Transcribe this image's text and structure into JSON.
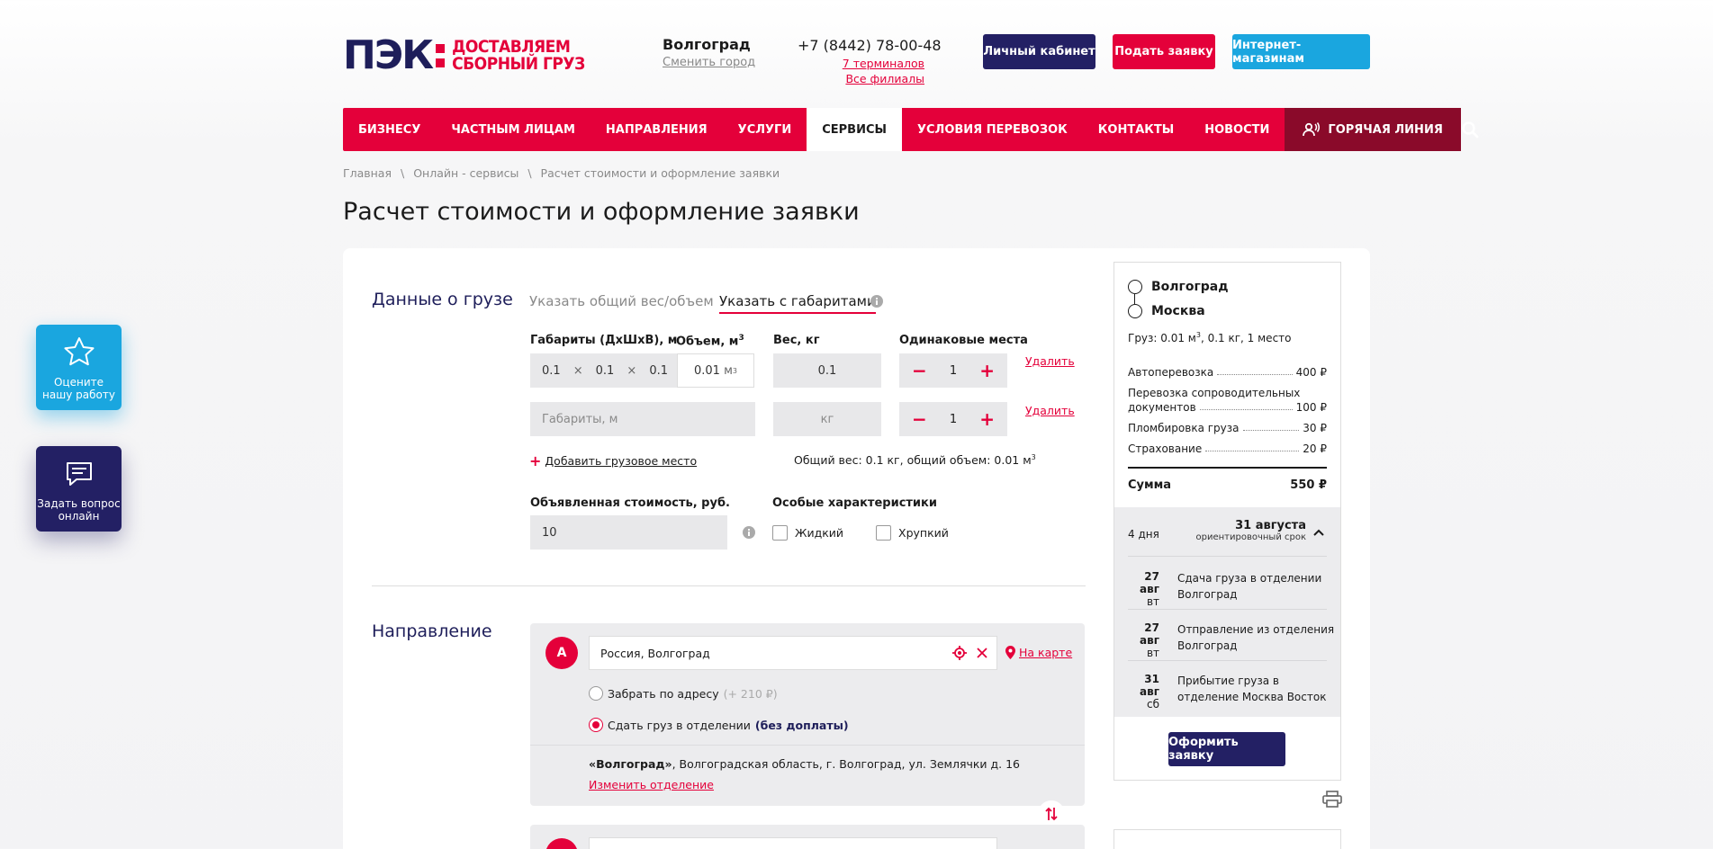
{
  "header": {
    "logo_mark": "ПЭК",
    "logo_text_1": "ДОСТАВЛЯЕМ",
    "logo_text_2": "СБОРНЫЙ ГРУЗ",
    "city": "Волгоград",
    "change_city": "Сменить город",
    "phone": "+7 (8442) 78-00-48",
    "terminals": "7 терминалов",
    "branches": "Все филиалы",
    "btn_account": "Личный кабинет",
    "btn_order": "Подать заявку",
    "btn_shops": "Интернет-магазинам"
  },
  "nav": {
    "items": [
      "БИЗНЕСУ",
      "ЧАСТНЫМ ЛИЦАМ",
      "НАПРАВЛЕНИЯ",
      "УСЛУГИ",
      "СЕРВИСЫ",
      "УСЛОВИЯ ПЕРЕВОЗОК",
      "КОНТАКТЫ",
      "НОВОСТИ"
    ],
    "hotline": "ГОРЯЧАЯ ЛИНИЯ"
  },
  "breadcrumbs": [
    "Главная",
    "\\",
    "Онлайн - сервисы",
    "\\",
    "Расчет стоимости и оформление заявки"
  ],
  "page_title": "Расчет стоимости и оформление заявки",
  "cargo": {
    "title": "Данные о грузе",
    "tab_total": "Указать общий вес/объем",
    "tab_dims": "Указать с габаритами",
    "lbl_dims": "Габариты (ДхШхВ), м",
    "lbl_volume": "Объем, м",
    "sup3": "3",
    "lbl_weight": "Вес, кг",
    "lbl_same": "Одинаковые места",
    "row1": {
      "l": "0.1",
      "w": "0.1",
      "h": "0.1",
      "x": "×",
      "volume": "0.01",
      "vol_unit": "м",
      "weight": "0.1",
      "qty": "1",
      "delete": "Удалить"
    },
    "row2": {
      "dims_placeholder": "Габариты, м",
      "weight_placeholder": "кг",
      "qty": "1",
      "delete": "Удалить"
    },
    "add_place": "Добавить грузовое место",
    "plus": "+",
    "total": "Общий вес: 0.1 кг, общий объем: 0.01 м",
    "lbl_declared": "Объявленная стоимость, руб.",
    "declared": "10",
    "lbl_special": "Особые характеристики",
    "liquid": "Жидкий",
    "fragile": "Хрупкий",
    "minus": "−",
    "plus_sign": "+"
  },
  "direction": {
    "title": "Направление",
    "point_a": "A",
    "address": "Россия, Волгоград",
    "map_link": "На карте",
    "pickup": "Забрать по адресу",
    "pickup_price": "(+ 210 ₽)",
    "dropoff": "Сдать груз в отделении",
    "dropoff_note": "(без доплаты)",
    "office_name": "«Волгоград»",
    "office_addr": ", Волгоградская область, г. Волгоград, ул. Землячки д. 16",
    "change_office": "Изменить отделение"
  },
  "summary": {
    "from": "Волгоград",
    "to": "Москва",
    "cargo_line": "Груз: 0.01 м",
    "cargo_line_2": ", 0.1 кг, 1 место",
    "sup3": "3",
    "items": [
      {
        "name": "Автоперевозка",
        "price": "400 ₽"
      },
      {
        "name": "Перевозка сопроводительных",
        "name2": "документов",
        "price": "100 ₽"
      },
      {
        "name": "Пломбировка груза",
        "price": "30 ₽"
      },
      {
        "name": "Страхование",
        "price": "20 ₽"
      }
    ],
    "total_label": "Сумма",
    "total": "550 ₽",
    "days": "4 дня",
    "date": "31 августа",
    "date_note": "ориентировочный срок",
    "timeline": [
      {
        "d": "27 авг",
        "wd": "вт",
        "t1": "Сдача груза в отделении",
        "t2": "Волгоград"
      },
      {
        "d": "27 авг",
        "wd": "вт",
        "t1": "Отправление из отделения",
        "t2": "Волгоград"
      },
      {
        "d": "31 авг",
        "wd": "сб",
        "t1": "Прибытие груза в",
        "t2": "отделение Москва Восток"
      }
    ],
    "btn": "Оформить заявку"
  },
  "floating": {
    "rate_1": "Оцените",
    "rate_2": "нашу работу",
    "ask_1": "Задать вопрос",
    "ask_2": "онлайн"
  },
  "colors": {
    "brand_red": "#e4003a",
    "brand_navy": "#232064",
    "cyan": "#1aa6df",
    "hot_dark": "#8a0a2a"
  }
}
